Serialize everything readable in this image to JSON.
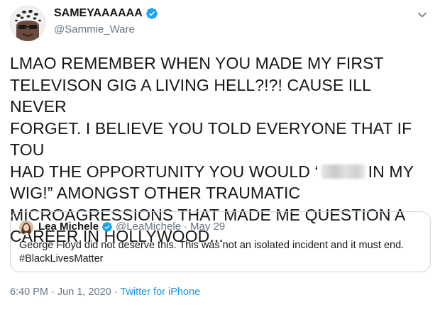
{
  "author": {
    "display_name": "SAMEYAAAAAA",
    "handle": "@Sammie_Ware",
    "avatar_icon": "profile-photo-leopard-hat",
    "verified_icon": "verified-badge-icon"
  },
  "menu_icon": "chevron-down-icon",
  "tweet": {
    "text_part1": "LMAO REMEMBER WHEN YOU MADE MY FIRST\nTELEVISON GIG A LIVING HELL?!?! CAUSE ILL NEVER\nFORGET. I BELIEVE YOU TOLD EVERYONE THAT IF TOU\nHAD THE OPPORTUNITY YOU WOULD ‘",
    "text_part2": "IN MY\nWIG!” AMONGST OTHER TRAUMATIC\nMICROAGRESSIONS THAT MADE ME QUESTION A\nCAREER IN HOLLYWOOD..."
  },
  "quoted": {
    "display_name": "Lea Michele",
    "handle": "@LeaMichele",
    "separator": "·",
    "date": "May 29",
    "text": "George Floyd did not deserve this. This was not an isolated incident and it must end. #BlackLivesMatter"
  },
  "footer": {
    "time": "6:40 PM",
    "separator": "·",
    "date": "Jun 1, 2020",
    "source": "Twitter for iPhone"
  },
  "colors": {
    "primary_text": "#14171a",
    "secondary_text": "#657786",
    "link": "#1b95e0",
    "verified": "#1da1f2",
    "border": "#ccd6dd"
  }
}
